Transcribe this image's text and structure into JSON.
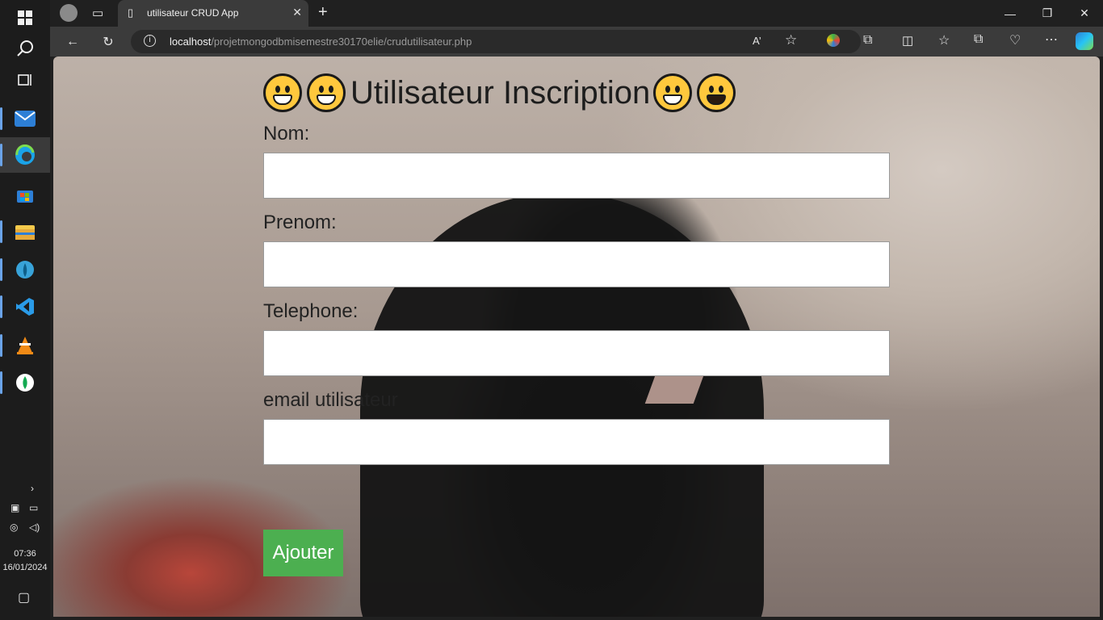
{
  "browser": {
    "tab_title": "utilisateur CRUD App",
    "tab_close": "✕",
    "new_tab": "+",
    "url_host": "localhost",
    "url_path": "/projetmongodbmisemestre30170elie/crudutilisateur.php",
    "read_aloud": "A’"
  },
  "window": {
    "minimize": "—",
    "restore": "❐",
    "close": "✕"
  },
  "taskbar": {
    "time": "07:36",
    "date": "16/01/2024"
  },
  "form": {
    "title": "Utilisateur Inscription",
    "fields": [
      {
        "label": "Nom:"
      },
      {
        "label": "Prenom:"
      },
      {
        "label": "Telephone:"
      },
      {
        "label": "email utilisateur"
      }
    ],
    "submit_label": "Ajouter"
  },
  "colors": {
    "submit": "#4caf50",
    "accent": "#6aa3e8"
  }
}
